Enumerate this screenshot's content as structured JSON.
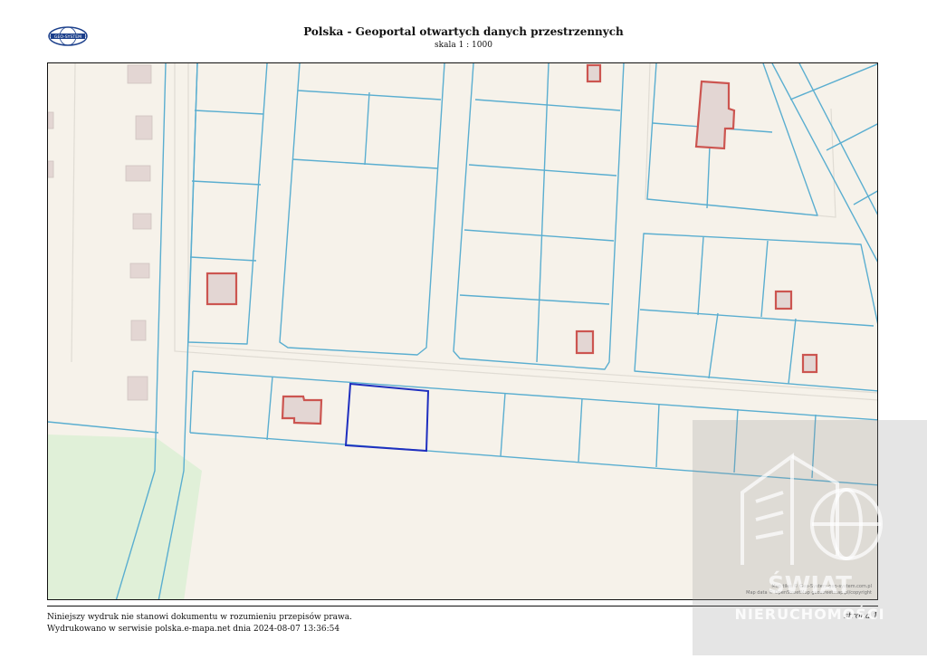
{
  "header": {
    "title": "Polska - Geoportal otwartych danych przestrzennych",
    "scale": "skala 1 : 1000",
    "logo_text": "GEO-SYSTEM"
  },
  "map": {
    "attribution_line1": "Map tiles © Geo-System geo-system.com.pl",
    "attribution_line2": "Map data © OpenStreetMap geostreetmap.pl/copyright",
    "colors": {
      "background": "#f6f2ea",
      "parcel_line": "#5aaed0",
      "building_fill": "#e3d6d3",
      "building_outline": "#cc5550",
      "selected_parcel": "#1f2fbf",
      "green_area": "#dff0d8"
    }
  },
  "footer": {
    "disclaimer": "Niniejszy wydruk nie stanowi dokumentu w rozumieniu przepisów prawa.",
    "printed": "Wydrukowano w serwisie polska.e-mapa.net dnia 2024-08-07 13:36:54",
    "page": "strona 1"
  },
  "watermark": {
    "title": "ŚWIAT",
    "subtitle": "NIERUCHOMOŚCI"
  }
}
